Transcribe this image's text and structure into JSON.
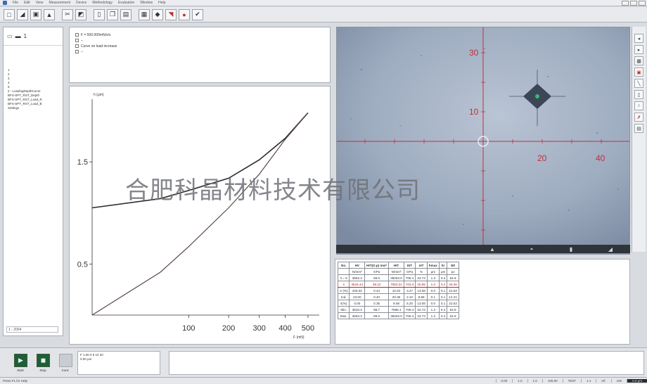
{
  "titlebar": {
    "menu": [
      "File",
      "Edit",
      "View",
      "Measurement",
      "Device",
      "Methodology",
      "Evaluation",
      "Window",
      "Help"
    ]
  },
  "toolbar": {
    "buttons": [
      "new",
      "open",
      "save",
      "print",
      "cut",
      "copy",
      "paste",
      "undo",
      "tool",
      "tool",
      "tool",
      "tool",
      "tool"
    ]
  },
  "leftpanel": {
    "header": "1",
    "tree": [
      "1",
      "2",
      "3",
      "4",
      "5",
      "2 - LoadingDepthCurve",
      "BFS-SPT_RST_Depth",
      "BFS-SPT_RST_Load_R",
      "BFS-SPT_RST_Load_B",
      "Settings"
    ],
    "footer": "1 - 2004"
  },
  "legend": {
    "items": [
      {
        "swatch": "",
        "label": "F = 500.000mN/s/s"
      },
      {
        "swatch": "",
        "label": "--"
      },
      {
        "swatch": "",
        "label": "Curve on load increase"
      },
      {
        "swatch": "",
        "label": "--"
      }
    ]
  },
  "chart_data": {
    "type": "line",
    "title": "",
    "xlabel": "F (mN)",
    "ylabel": "h (μm)",
    "xscale": "sqrt",
    "xlim": [
      0,
      520
    ],
    "ylim": [
      0,
      2.1
    ],
    "xticks": [
      100,
      200,
      300,
      400,
      500
    ],
    "yticks": [
      0.5,
      1.5
    ],
    "series": [
      {
        "values": [
          [
            0,
            1.05
          ],
          [
            50,
            1.14
          ],
          [
            100,
            1.22
          ],
          [
            200,
            1.34
          ],
          [
            300,
            1.52
          ],
          [
            400,
            1.73
          ],
          [
            500,
            1.98
          ]
        ]
      },
      {
        "values": [
          [
            0,
            0.0
          ],
          [
            50,
            0.42
          ],
          [
            100,
            0.67
          ],
          [
            200,
            1.05
          ],
          [
            300,
            1.38
          ],
          [
            400,
            1.72
          ],
          [
            500,
            1.98
          ]
        ]
      }
    ]
  },
  "image": {
    "axis_labels": [
      "30",
      "10",
      "20",
      "40"
    ]
  },
  "imagebar": {
    "buttons": [
      "camera",
      "zoom",
      "focus",
      "export"
    ]
  },
  "rightbar": {
    "tools": [
      "select",
      "measure",
      "zoom",
      "calibrate",
      "tool",
      "tool",
      "tool",
      "tool",
      "tool"
    ]
  },
  "results_table": {
    "headers": [
      "No.",
      "HV",
      "HIT(O.p) mm²",
      "HIT",
      "EIT",
      "nIT",
      "hmax",
      "hr",
      "Wt"
    ],
    "units": [
      "",
      "N/mm²",
      "GPa",
      "N/mm²",
      "GPa",
      "%",
      "μm",
      "μm",
      "pJ"
    ],
    "rows": [
      [
        "x̄ = 6",
        "3553.3",
        "89.0",
        "38253.0",
        "706.4",
        "34.73",
        "1.3",
        "0.4",
        "54.8"
      ],
      [
        "s",
        "3534.44",
        "38.22",
        "7053.31",
        "703.3",
        "20.55",
        "1.0",
        "0.2",
        "29.36"
      ],
      [
        "V (%)",
        "100.02",
        "0.44",
        "10.04",
        "3.27",
        "13.08",
        "0.0",
        "0.1",
        "22.53"
      ],
      [
        "Ind.",
        "23.00",
        "0.40",
        "20.36",
        "2.10",
        "8.98",
        "0.1",
        "0.1",
        "12.21"
      ],
      [
        "x̄(%)",
        "0.00",
        "0.35",
        "9.08",
        "5.20",
        "13.08",
        "0.0",
        "0.1",
        "22.53"
      ],
      [
        "Min.",
        "3533.3",
        "88.7",
        "7888.1",
        "706.4",
        "34.73",
        "1.3",
        "0.4",
        "54.8"
      ],
      [
        "Max.",
        "3553.3",
        "89.0",
        "38253.0",
        "706.4",
        "34.73",
        "1.3",
        "0.4",
        "54.8"
      ]
    ]
  },
  "controls": {
    "start_label": "Start",
    "stop_label": "Stop",
    "third_label": "Cont.",
    "message_line1": "F 1.00 0 5 10 20",
    "message_line2": "0.00 μm"
  },
  "statusbar": {
    "left": "Press F1 for Help",
    "fields": [
      "0.00",
      "1.0",
      "1.0",
      "100.00",
      "TEST",
      "1:1",
      "Inf.",
      "100",
      "0.0 μm"
    ]
  },
  "watermark": "合肥科晶材料技术有限公司"
}
